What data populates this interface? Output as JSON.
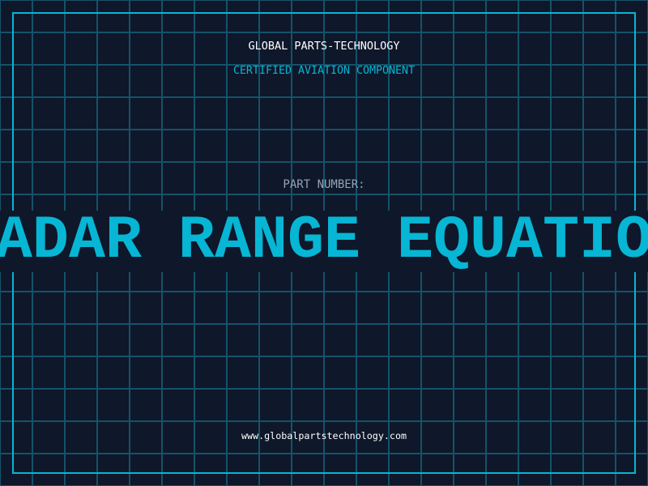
{
  "header": {
    "company": "GLOBAL PARTS-TECHNOLOGY",
    "subtitle": "CERTIFIED AVIATION COMPONENT"
  },
  "part": {
    "label": "PART NUMBER:",
    "value": "RADAR RANGE EQUATION"
  },
  "footer": {
    "url": "www.globalpartstechnology.com"
  },
  "colors": {
    "background": "#0f172a",
    "accent": "#06b6d4",
    "grid": "#155e75",
    "label": "#94a3b8"
  }
}
